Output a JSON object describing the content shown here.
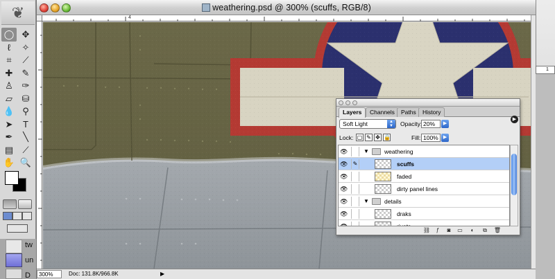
{
  "document": {
    "title": "weathering.psd @ 300% (scuffs, RGB/8)",
    "zoom": "300%",
    "doc_size": "Doc: 131.8K/966.8K",
    "ruler_top_label": "4"
  },
  "desktop": {
    "items": [
      {
        "label": "tw"
      },
      {
        "label": "un"
      },
      {
        "label": "D"
      }
    ]
  },
  "right_strip": {
    "ruler_label": "1"
  },
  "toolbox": {
    "tools": [
      {
        "name": "marquee",
        "glyph": "◯"
      },
      {
        "name": "move",
        "glyph": "✥"
      },
      {
        "name": "lasso",
        "glyph": "ℓ"
      },
      {
        "name": "magic-wand",
        "glyph": "✧"
      },
      {
        "name": "crop",
        "glyph": "⌗"
      },
      {
        "name": "slice",
        "glyph": "⟋"
      },
      {
        "name": "healing",
        "glyph": "✚"
      },
      {
        "name": "brush",
        "glyph": "✎"
      },
      {
        "name": "stamp",
        "glyph": "♙"
      },
      {
        "name": "history-brush",
        "glyph": "✑"
      },
      {
        "name": "eraser",
        "glyph": "▱"
      },
      {
        "name": "bucket",
        "glyph": "⛁"
      },
      {
        "name": "blur",
        "glyph": "💧"
      },
      {
        "name": "dodge",
        "glyph": "⚲"
      },
      {
        "name": "path-select",
        "glyph": "➤"
      },
      {
        "name": "type",
        "glyph": "T"
      },
      {
        "name": "pen",
        "glyph": "✒"
      },
      {
        "name": "line",
        "glyph": "╲"
      },
      {
        "name": "notes",
        "glyph": "▤"
      },
      {
        "name": "eyedropper",
        "glyph": "⟋"
      },
      {
        "name": "hand",
        "glyph": "✋"
      },
      {
        "name": "zoom",
        "glyph": "🔍"
      }
    ]
  },
  "layers_palette": {
    "tabs": [
      {
        "label": "Layers",
        "active": true
      },
      {
        "label": "Channels",
        "active": false
      },
      {
        "label": "Paths",
        "active": false
      },
      {
        "label": "History",
        "active": false
      }
    ],
    "blend_mode": "Soft Light",
    "opacity_label": "Opacity:",
    "opacity_value": "20%",
    "lock_label": "Lock:",
    "fill_label": "Fill:",
    "fill_value": "100%",
    "layers": [
      {
        "name": "weathering",
        "type": "group",
        "expanded": true,
        "visible": true,
        "selected": false,
        "indent": 0
      },
      {
        "name": "scuffs",
        "type": "layer",
        "visible": true,
        "selected": true,
        "indent": 1,
        "thumb": "checker",
        "brush": true
      },
      {
        "name": "faded",
        "type": "layer",
        "visible": true,
        "selected": false,
        "indent": 1,
        "thumb": "yellow"
      },
      {
        "name": "dirty panel lines",
        "type": "layer",
        "visible": true,
        "selected": false,
        "indent": 1,
        "thumb": "checker"
      },
      {
        "name": "details",
        "type": "group",
        "expanded": true,
        "visible": true,
        "selected": false,
        "indent": 0
      },
      {
        "name": "draks",
        "type": "layer",
        "visible": true,
        "selected": false,
        "indent": 1,
        "thumb": "checker"
      },
      {
        "name": "rivets",
        "type": "layer",
        "visible": true,
        "selected": false,
        "indent": 1,
        "thumb": "checker"
      }
    ],
    "bottom_buttons": [
      "link-layers",
      "layer-style",
      "mask",
      "new-group",
      "adjustment",
      "new-layer",
      "delete-layer"
    ]
  },
  "colors": {
    "olive": "#6a6746",
    "red": "#b43a33",
    "navy": "#2a2f6e",
    "cream": "#d9d5c3",
    "grey_panel": "#9aa0a6",
    "selection": "#b3cff7"
  }
}
